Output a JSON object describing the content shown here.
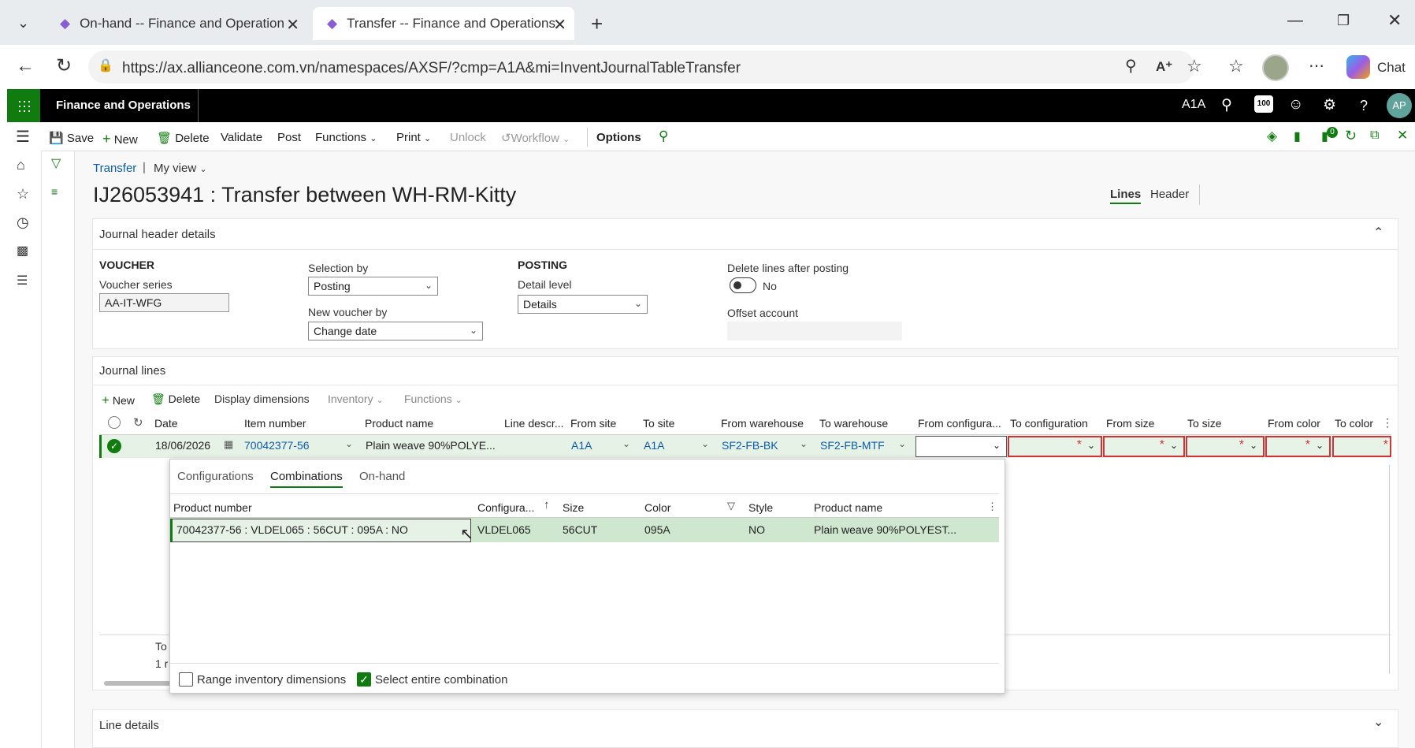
{
  "browser": {
    "tabs": [
      {
        "label": "On-hand -- Finance and Operation"
      },
      {
        "label": "Transfer -- Finance and Operations"
      }
    ],
    "url": "https://ax.allianceone.com.vn/namespaces/AXSF/?cmp=A1A&mi=InventJournalTableTransfer",
    "chat_label": "Chat"
  },
  "app": {
    "title": "Finance and Operations",
    "company": "A1A",
    "notification_count": "100",
    "user_initials": "AP"
  },
  "toolbar": {
    "save": "Save",
    "new": "New",
    "delete": "Delete",
    "validate": "Validate",
    "post": "Post",
    "functions": "Functions",
    "print": "Print",
    "unlock": "Unlock",
    "workflow": "Workflow",
    "options": "Options",
    "badge": "0"
  },
  "breadcrumb": {
    "root": "Transfer",
    "view": "My view"
  },
  "page": {
    "title": "IJ26053941 : Transfer between WH-RM-Kitty",
    "view_lines": "Lines",
    "view_header": "Header"
  },
  "header_details": {
    "section_title": "Journal header details",
    "voucher_heading": "VOUCHER",
    "voucher_series_label": "Voucher series",
    "voucher_series": "AA-IT-WFG",
    "selection_by_label": "Selection by",
    "selection_by": "Posting",
    "new_voucher_by_label": "New voucher by",
    "new_voucher_by": "Change date",
    "posting_heading": "POSTING",
    "detail_level_label": "Detail level",
    "detail_level": "Details",
    "delete_lines_label": "Delete lines after posting",
    "delete_lines_value": "No",
    "offset_account_label": "Offset account",
    "offset_account": ""
  },
  "journal_lines": {
    "section_title": "Journal lines",
    "actions": {
      "new": "New",
      "delete": "Delete",
      "display_dimensions": "Display dimensions",
      "inventory": "Inventory",
      "functions": "Functions"
    },
    "columns": [
      "Date",
      "Item number",
      "Product name",
      "Line descr...",
      "From site",
      "To site",
      "From warehouse",
      "To warehouse",
      "From configura...",
      "To configuration",
      "From size",
      "To size",
      "From color",
      "To color"
    ],
    "row": {
      "date": "18/06/2026",
      "item_number": "70042377-56",
      "product_name": "Plain weave 90%POLYE...",
      "line_description": "",
      "from_site": "A1A",
      "to_site": "A1A",
      "from_warehouse": "SF2-FB-BK",
      "to_warehouse": "SF2-FB-MTF",
      "from_configuration": ""
    },
    "footer_partial_1": "To",
    "footer_partial_2": "1 r"
  },
  "lookup": {
    "tabs": [
      "Configurations",
      "Combinations",
      "On-hand"
    ],
    "active_tab": "Combinations",
    "columns": [
      "Product number",
      "Configura...",
      "Size",
      "Color",
      "Style",
      "Product name"
    ],
    "row": {
      "product_number": "70042377-56 : VLDEL065 : 56CUT : 095A : NO",
      "configuration": "VLDEL065",
      "size": "56CUT",
      "color": "095A",
      "style": "NO",
      "product_name": "Plain weave 90%POLYEST..."
    },
    "range_label": "Range inventory dimensions",
    "range_checked": false,
    "select_combination_label": "Select entire combination",
    "select_combination_checked": true
  },
  "line_details": {
    "section_title": "Line details"
  }
}
